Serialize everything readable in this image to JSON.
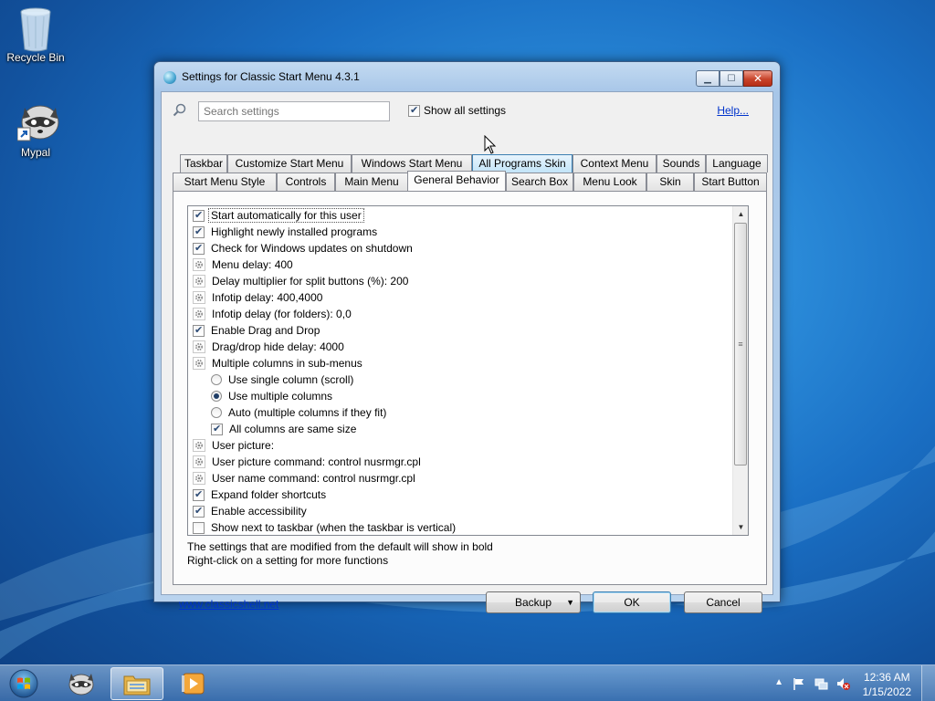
{
  "desktop": {
    "icons": [
      {
        "label": "Recycle Bin",
        "icon": "recycle-bin-icon"
      },
      {
        "label": "Mypal",
        "icon": "raccoon-browser-icon"
      }
    ]
  },
  "window": {
    "title": "Settings for Classic Start Menu 4.3.1",
    "search_placeholder": "Search settings",
    "show_all_label": "Show all settings",
    "show_all_checked": true,
    "help_label": "Help...",
    "tabs_row1": [
      "Taskbar",
      "Customize Start Menu",
      "Windows Start Menu",
      "All Programs Skin",
      "Context Menu",
      "Sounds",
      "Language"
    ],
    "tabs_row2": [
      "Start Menu Style",
      "Controls",
      "Main Menu",
      "General Behavior",
      "Search Box",
      "Menu Look",
      "Skin",
      "Start Button"
    ],
    "active_tab": "General Behavior",
    "settings": [
      {
        "type": "checkbox",
        "checked": true,
        "label": "Start automatically for this user",
        "selected": true
      },
      {
        "type": "checkbox",
        "checked": true,
        "label": "Highlight newly installed programs"
      },
      {
        "type": "checkbox",
        "checked": true,
        "label": "Check for Windows updates on shutdown"
      },
      {
        "type": "value",
        "label": "Menu delay: 400"
      },
      {
        "type": "value",
        "label": "Delay multiplier for split buttons (%): 200"
      },
      {
        "type": "value",
        "label": "Infotip delay: 400,4000"
      },
      {
        "type": "value",
        "label": "Infotip delay (for folders): 0,0"
      },
      {
        "type": "checkbox",
        "checked": true,
        "label": "Enable Drag and Drop"
      },
      {
        "type": "value",
        "label": "Drag/drop hide delay: 4000"
      },
      {
        "type": "value",
        "label": "Multiple columns in sub-menus"
      },
      {
        "type": "radio",
        "checked": false,
        "label": "Use single column (scroll)",
        "indent": true
      },
      {
        "type": "radio",
        "checked": true,
        "label": "Use multiple columns",
        "indent": true
      },
      {
        "type": "radio",
        "checked": false,
        "label": "Auto (multiple columns if they fit)",
        "indent": true
      },
      {
        "type": "checkbox",
        "checked": true,
        "label": "All columns are same size",
        "indent": true
      },
      {
        "type": "value",
        "label": "User picture:"
      },
      {
        "type": "value",
        "label": "User picture command: control nusrmgr.cpl"
      },
      {
        "type": "value",
        "label": "User name command: control nusrmgr.cpl"
      },
      {
        "type": "checkbox",
        "checked": true,
        "label": "Expand folder shortcuts"
      },
      {
        "type": "checkbox",
        "checked": true,
        "label": "Enable accessibility"
      },
      {
        "type": "checkbox",
        "checked": false,
        "label": "Show next to taskbar (when the taskbar is vertical)"
      }
    ],
    "notes": [
      "The settings that are modified from the default will show in bold",
      "Right-click on a setting for more functions"
    ],
    "website_link": "www.classicshell.net",
    "backup_label": "Backup",
    "ok_label": "OK",
    "cancel_label": "Cancel"
  },
  "taskbar": {
    "items": [
      "start-orb-icon",
      "mypal-icon",
      "file-explorer-icon",
      "media-player-icon"
    ],
    "clock_time": "12:36 AM",
    "clock_date": "1/15/2022"
  }
}
